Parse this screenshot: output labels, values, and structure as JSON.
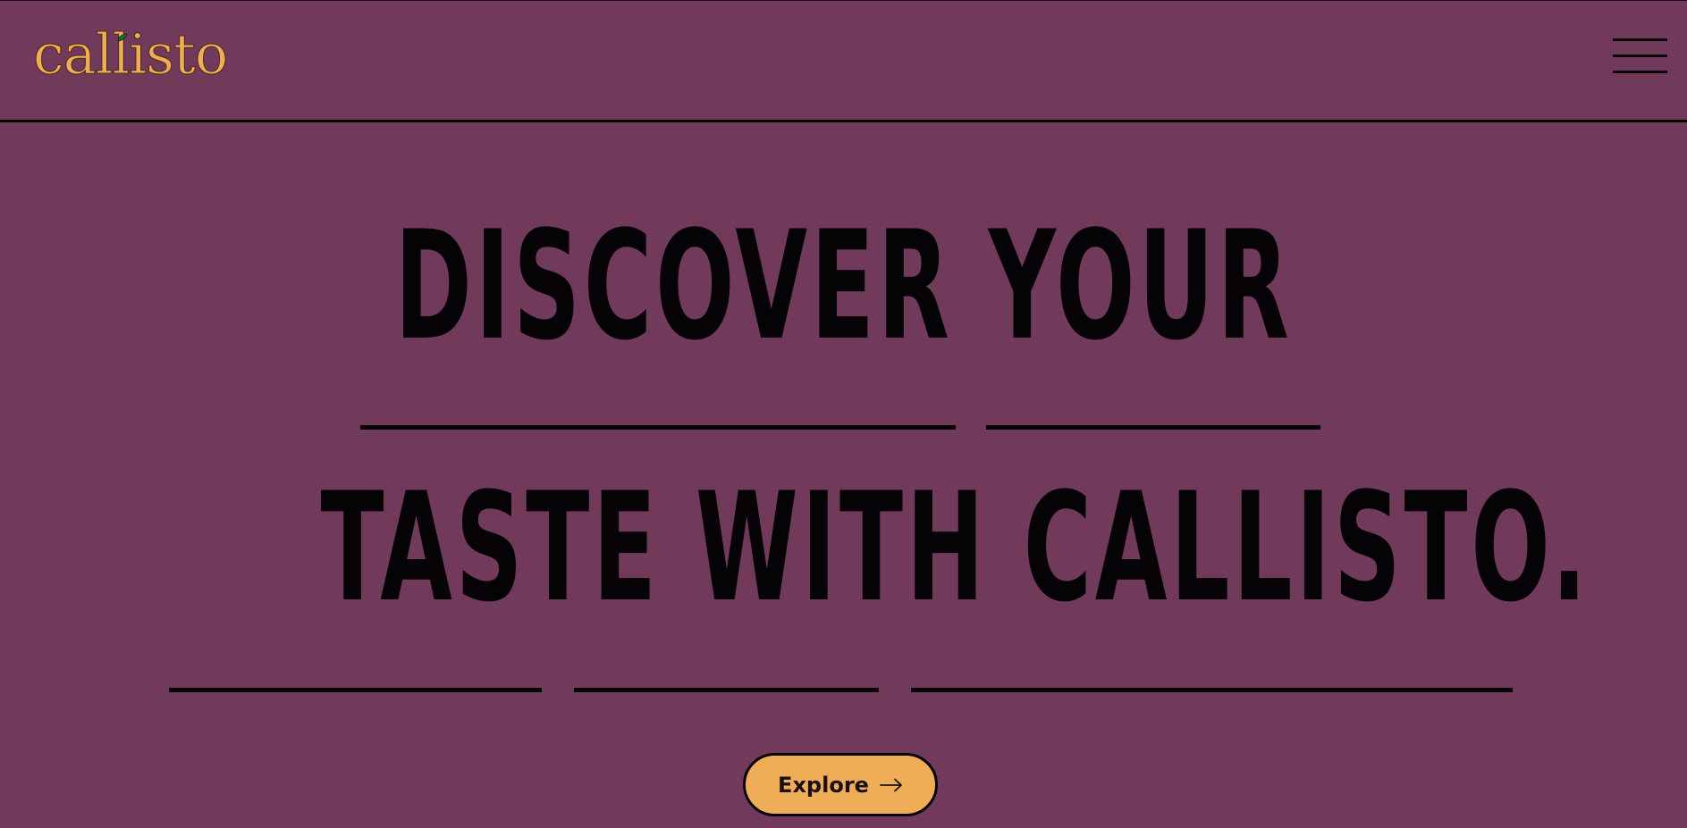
{
  "brand": {
    "logo_text": "callisto"
  },
  "header": {
    "menu_icon": "hamburger-menu-icon"
  },
  "hero": {
    "line1": "DISCOVER YOUR",
    "line2": "TASTE WITH CALLISTO.",
    "cta_label": "Explore",
    "cta_icon": "arrow-right-icon"
  },
  "colors": {
    "background": "#723a5a",
    "accent": "#efad58",
    "text": "#050305"
  }
}
